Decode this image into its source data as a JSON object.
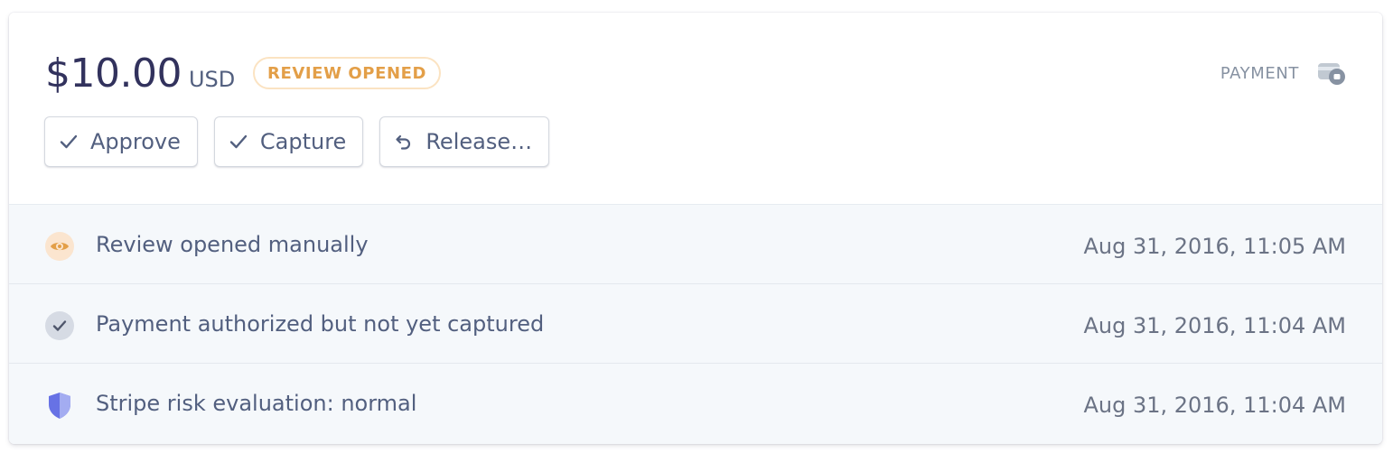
{
  "payment": {
    "amount": "$10.00",
    "currency": "USD",
    "status": "REVIEW OPENED",
    "type_label": "PAYMENT",
    "icon": "card-icon"
  },
  "actions": [
    {
      "label": "Approve",
      "icon": "check-icon"
    },
    {
      "label": "Capture",
      "icon": "check-icon"
    },
    {
      "label": "Release…",
      "icon": "undo-icon"
    }
  ],
  "timeline": [
    {
      "text": "Review opened manually",
      "time": "Aug 31, 2016, 11:05 AM",
      "icon": "eye-icon"
    },
    {
      "text": "Payment authorized but not yet captured",
      "time": "Aug 31, 2016, 11:04 AM",
      "icon": "check-circle-icon"
    },
    {
      "text": "Stripe risk evaluation: normal",
      "time": "Aug 31, 2016, 11:04 AM",
      "icon": "shield-icon"
    }
  ],
  "colors": {
    "accent_orange": "#e39f48",
    "badge_border": "#fbe3c2",
    "title_text": "#32325d",
    "body_text": "#525f7f",
    "muted_text": "#8792a2",
    "timeline_bg": "#f5f8fb",
    "shield_blue": "#6772e5"
  }
}
